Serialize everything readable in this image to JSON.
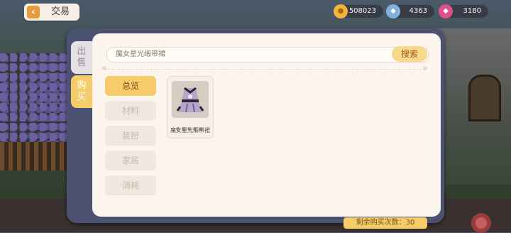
{
  "header": {
    "title": "交易",
    "back_icon": "back-arrow-icon"
  },
  "currencies": {
    "gold": {
      "value": "508023",
      "icon": "gold-coin-icon",
      "color": "#f2b43a"
    },
    "diamond": {
      "value": "4363",
      "icon": "diamond-icon",
      "color": "#7fb0e0"
    },
    "gem": {
      "value": "3180",
      "icon": "pink-gem-icon",
      "color": "#e0508a"
    }
  },
  "side_tabs": [
    {
      "label": "出\n售",
      "active": false
    },
    {
      "label": "购\n买",
      "active": true
    }
  ],
  "search": {
    "value": "魔女星光缎带裙",
    "button_label": "搜索"
  },
  "categories": [
    {
      "label": "总览",
      "active": true
    },
    {
      "label": "材料",
      "active": false
    },
    {
      "label": "装扮",
      "active": false
    },
    {
      "label": "家居",
      "active": false
    },
    {
      "label": "消耗",
      "active": false
    }
  ],
  "items": [
    {
      "name": "魔女星光缎带裙",
      "icon": "witch-dress-icon"
    }
  ],
  "footer": {
    "remaining": "剩余购买次数：30"
  },
  "colors": {
    "accent": "#f6cc6a",
    "panel_frame": "#4b5272",
    "panel_bg": "#fbf5ee"
  }
}
